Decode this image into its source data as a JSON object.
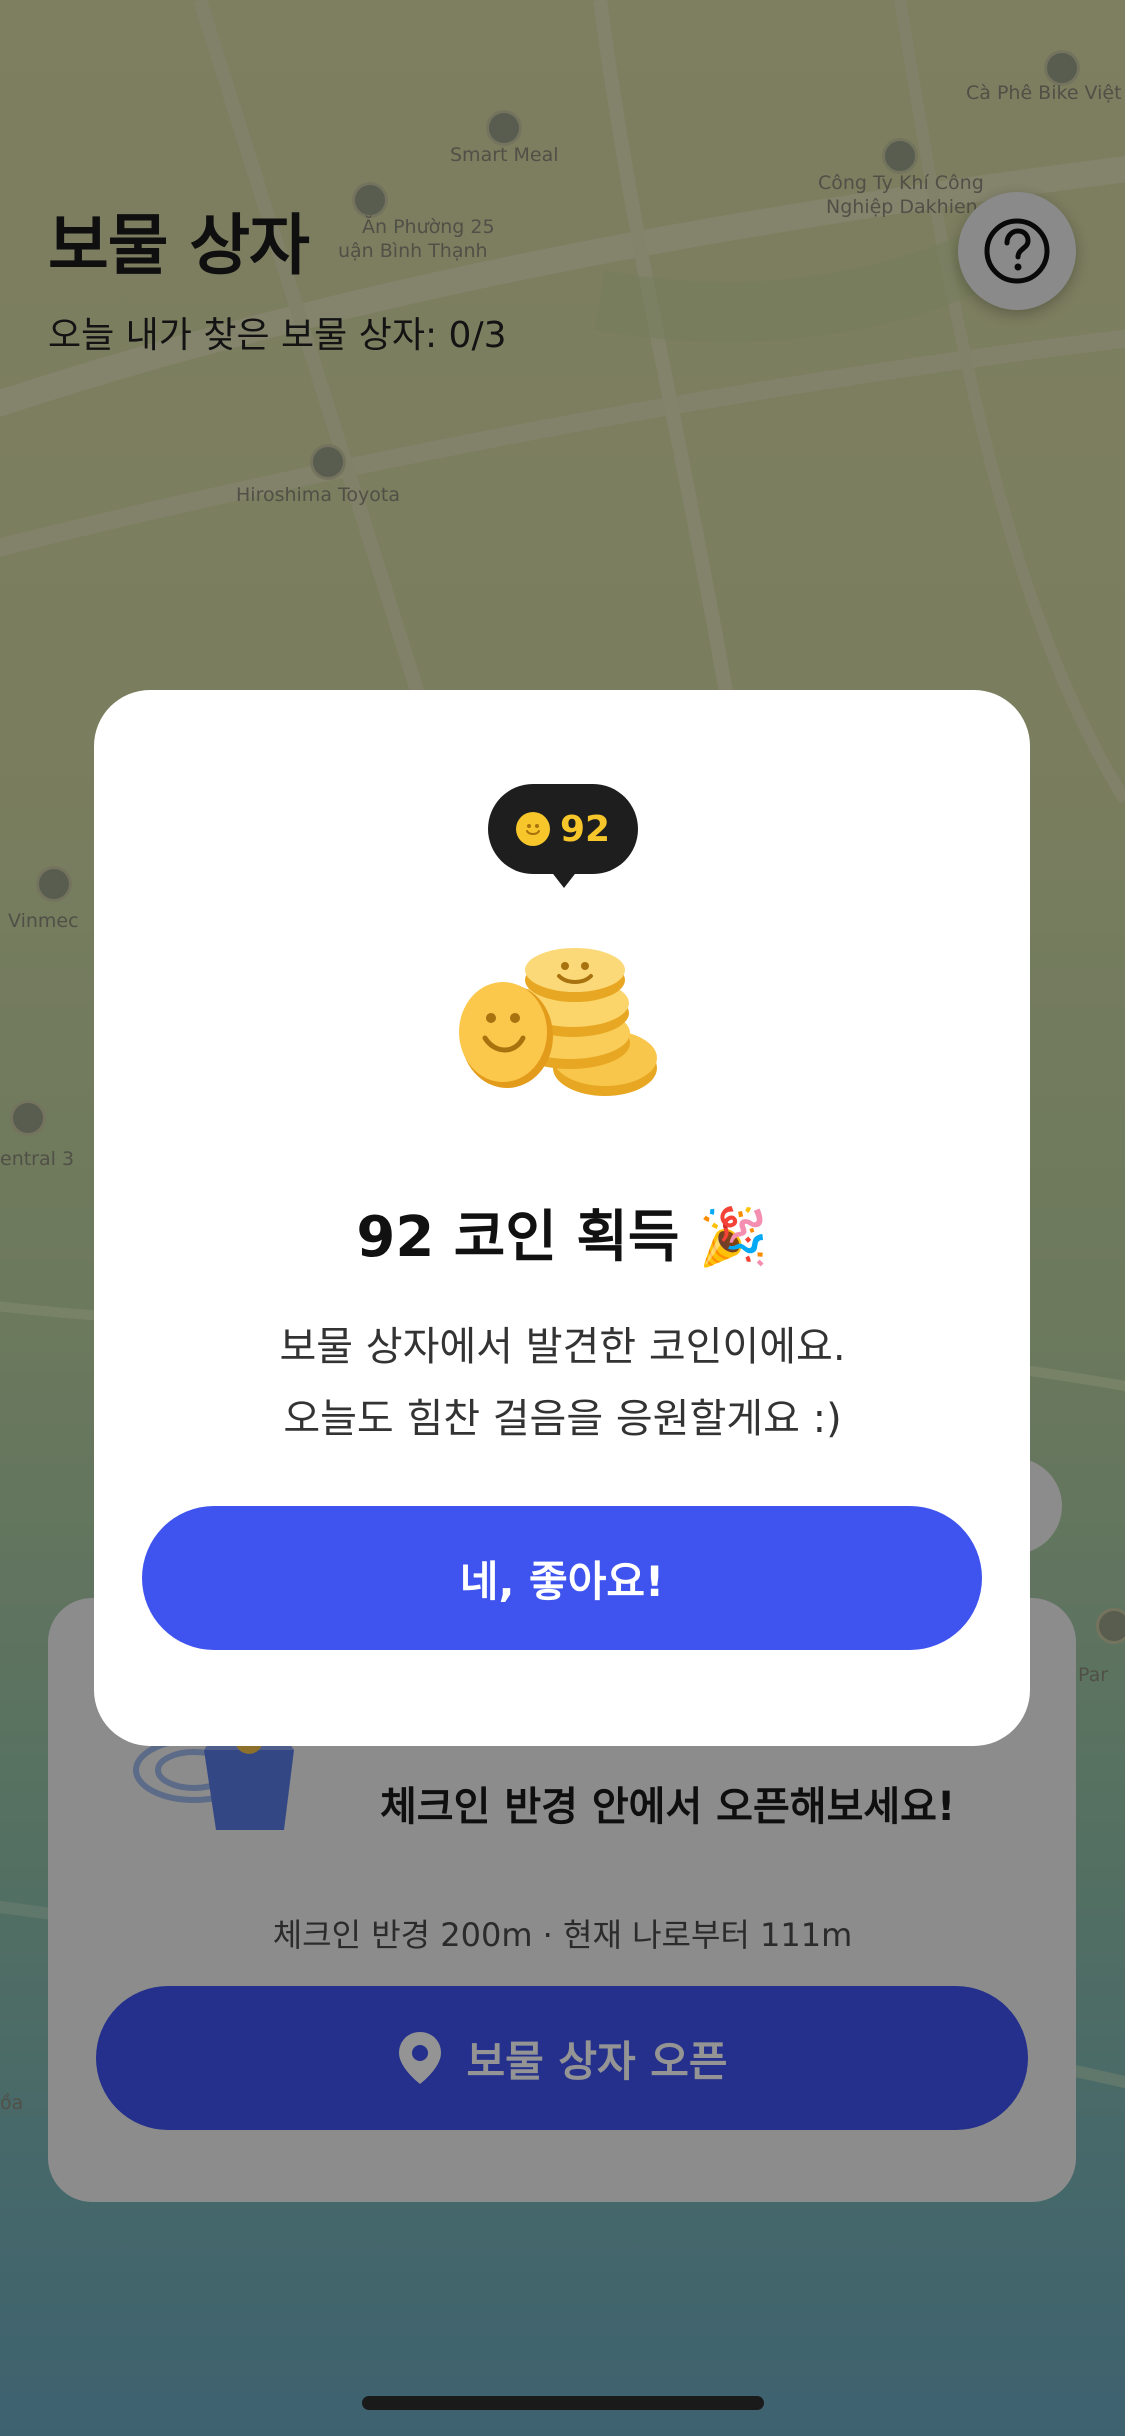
{
  "header": {
    "title": "보물 상자",
    "subtitle": "오늘 내가 찾은 보물 상자: 0/3",
    "help_icon": "question-circle-icon"
  },
  "map_labels": {
    "cafe": "Cà Phê Bike Việt N",
    "smart_meal": "Smart Meal",
    "company": "Công Ty Khí Công",
    "company2": "Nghiệp Dakhien",
    "phuong": "Ăn Phường 25",
    "binh_thanh": "uận Bình Thạnh",
    "toyota": "Hiroshima Toyota",
    "vinmec": "Vinmec",
    "central": "entral 3",
    "par": "Par",
    "toa": "ồa"
  },
  "background_card": {
    "line2": "체크인 반경 안에서 오픈해보세요!",
    "info": "체크인 반경 200m · 현재 나로부터 111m",
    "open_button_label": "보물 상자 오픈",
    "open_button_icon": "location-pin-icon"
  },
  "modal": {
    "coin_badge_value": "92",
    "coin_badge_icon": "smiley-coin-icon",
    "title": "92 코인 획득 🎉",
    "desc_line1": "보물 상자에서 발견한 코인이에요.",
    "desc_line2": "오늘도 힘찬 걸음을 응원할게요 :)",
    "confirm_label": "네, 좋아요!"
  },
  "colors": {
    "accent": "#3f54ef",
    "coin": "#f7c62a",
    "tooltip_bg": "#1e1e1e"
  }
}
